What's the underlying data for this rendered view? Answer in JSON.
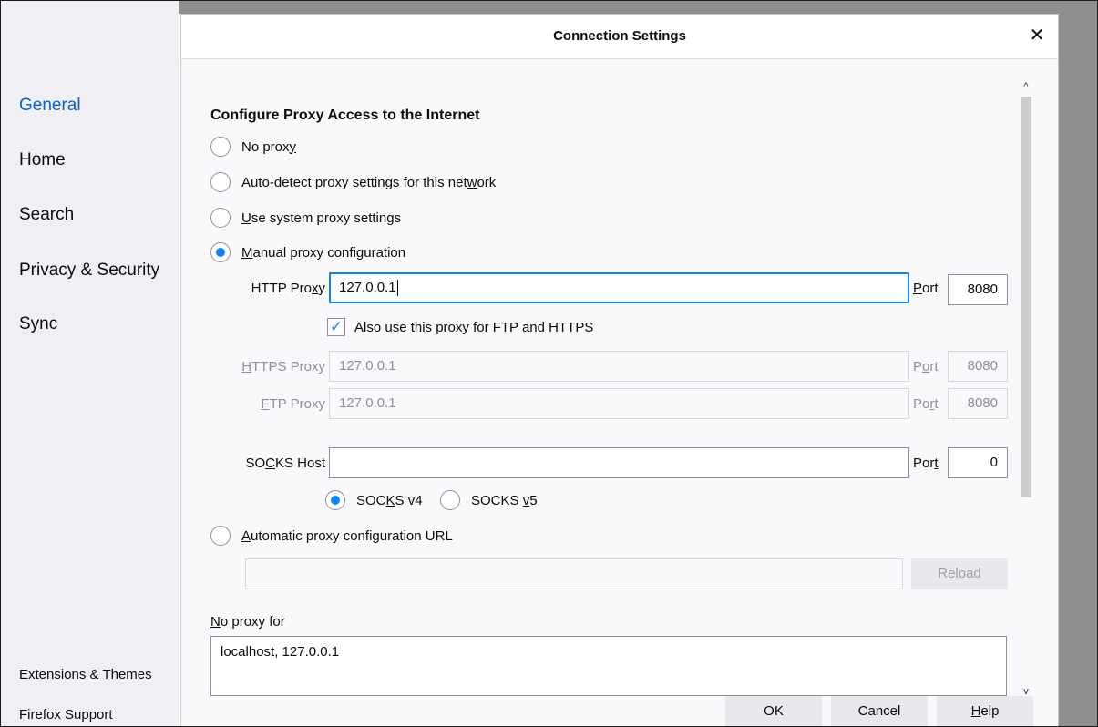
{
  "sidebar": {
    "items": [
      {
        "label": "General",
        "active": true
      },
      {
        "label": "Home",
        "active": false
      },
      {
        "label": "Search",
        "active": false
      },
      {
        "label": "Privacy & Security",
        "active": false
      },
      {
        "label": "Sync",
        "active": false
      }
    ],
    "extensions_label": "Extensions & Themes",
    "support_label": "Firefox Support"
  },
  "dialog": {
    "title": "Connection Settings",
    "close_glyph": "✕",
    "section_title": "Configure Proxy Access to the Internet",
    "options": {
      "no_proxy": {
        "pre": "No prox",
        "u": "y",
        "post": ""
      },
      "auto_detect": {
        "pre": "Auto-detect proxy settings for this net",
        "u": "w",
        "post": "ork"
      },
      "system": {
        "pre": "",
        "u": "U",
        "post": "se system proxy settings"
      },
      "manual": {
        "pre": "",
        "u": "M",
        "post": "anual proxy configuration"
      },
      "auto_url": {
        "pre": "",
        "u": "A",
        "post": "utomatic proxy configuration URL"
      }
    },
    "selected_option": "manual",
    "http": {
      "label_pre": "HTTP Pro",
      "label_u": "x",
      "label_post": "y",
      "value": "127.0.0.1",
      "port_label_u": "P",
      "port_label_post": "ort",
      "port": "8080"
    },
    "also_use": {
      "pre": "Al",
      "u": "s",
      "post": "o use this proxy for FTP and HTTPS",
      "checked": true,
      "check_glyph": "✓"
    },
    "https": {
      "label_pre": "",
      "label_u": "H",
      "label_post": "TTPS Proxy",
      "value": "127.0.0.1",
      "port_label_pre": "P",
      "port_label_u": "o",
      "port_label_post": "rt",
      "port": "8080"
    },
    "ftp": {
      "label_pre": "",
      "label_u": "F",
      "label_post": "TP Proxy",
      "value": "127.0.0.1",
      "port_label_pre": "Po",
      "port_label_u": "r",
      "port_label_post": "t",
      "port": "8080"
    },
    "socks": {
      "label_pre": "SO",
      "label_u": "C",
      "label_post": "KS Host",
      "value": "",
      "port_label_pre": "Por",
      "port_label_u": "t",
      "port_label_post": "",
      "port": "0",
      "v4": {
        "pre": "SOC",
        "u": "K",
        "post": "S v4"
      },
      "v5": {
        "pre": "SOCKS ",
        "u": "v",
        "post": "5"
      },
      "selected_version": "v4"
    },
    "auto_url_value": "",
    "reload": {
      "pre": "R",
      "u": "e",
      "post": "load"
    },
    "no_proxy_for": {
      "label_u": "N",
      "label_post": "o proxy for",
      "value": "localhost, 127.0.0.1"
    },
    "buttons": {
      "ok": "OK",
      "cancel": "Cancel",
      "help_u": "H",
      "help_post": "elp"
    },
    "scroll_up_glyph": "^",
    "scroll_down_glyph": "v"
  }
}
